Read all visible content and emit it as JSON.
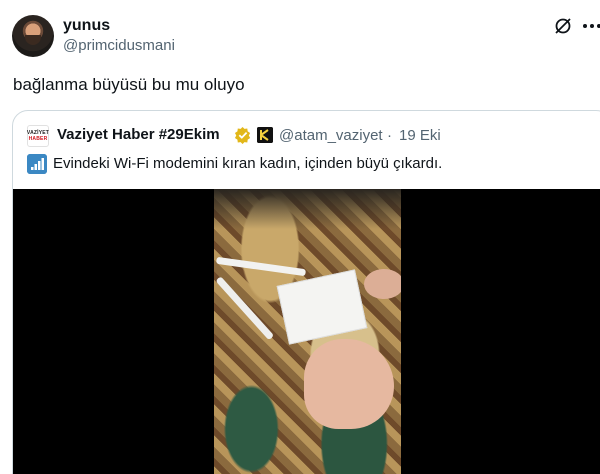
{
  "tweet": {
    "author_name": "yunus",
    "author_handle": "@primcidusmani",
    "text": "bağlanma büyüsü bu mu oluyo"
  },
  "quoted_tweet": {
    "logo_line1": "VAZİYET",
    "logo_line2": "HABER",
    "author_name": "Vaziyet Haber #29Ekim",
    "author_handle": "@atam_vaziyet",
    "separator": "·",
    "date": "19 Eki",
    "text": "Evindeki Wi-Fi modemini kıran kadın, içinden büyü çıkardı."
  },
  "colors": {
    "verified_gold": "#e2b719",
    "secondary_text": "#536471",
    "border": "#cfd9de"
  },
  "icons": [
    "grok-icon",
    "more-icon",
    "verified-icon",
    "affiliate-icon",
    "signal-bars-icon"
  ]
}
